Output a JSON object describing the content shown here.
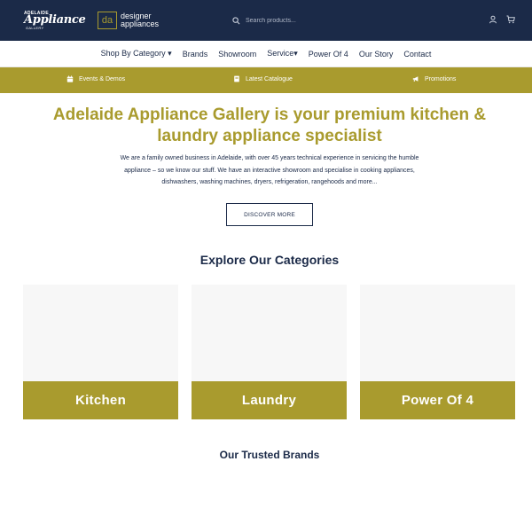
{
  "header": {
    "logo_main_small": "ADELAIDE",
    "logo_main_big": "Appliance",
    "logo_main_sub": "GALLERY",
    "logo_da": "da",
    "logo_designer_line1": "designer",
    "logo_designer_line2": "appliances",
    "search_placeholder": "Search products...",
    "icons": [
      "search-icon",
      "user-icon",
      "cart-icon"
    ]
  },
  "nav": {
    "items": [
      "Shop By Category ▾",
      "Brands",
      "Showroom",
      "Service▾",
      "Power Of 4",
      "Our Story",
      "Contact"
    ]
  },
  "promo": {
    "items": [
      {
        "label": "Events & Demos",
        "icon": "calendar-icon"
      },
      {
        "label": "Latest Catalogue",
        "icon": "book-icon"
      },
      {
        "label": "Promotions",
        "icon": "megaphone-icon"
      }
    ]
  },
  "hero": {
    "title_line1": "Adelaide Appliance Gallery is your premium kitchen &",
    "title_line2": "laundry appliance specialist",
    "text_line1": "We are a family owned business in Adelaide, with over 45 years technical experience in servicing the humble",
    "text_line2": "appliance – so we know our stuff. We have an interactive showroom and specialise in cooking appliances,",
    "text_line3": "dishwashers, washing machines, dryers, refrigeration, rangehoods and more...",
    "button": "DISCOVER MORE"
  },
  "categories": {
    "title": "Explore Our Categories",
    "items": [
      "Kitchen",
      "Laundry",
      "Power Of 4"
    ]
  },
  "brands": {
    "title": "Our Trusted Brands"
  },
  "colors": {
    "navy": "#1b2a48",
    "gold": "#a99b2e"
  }
}
